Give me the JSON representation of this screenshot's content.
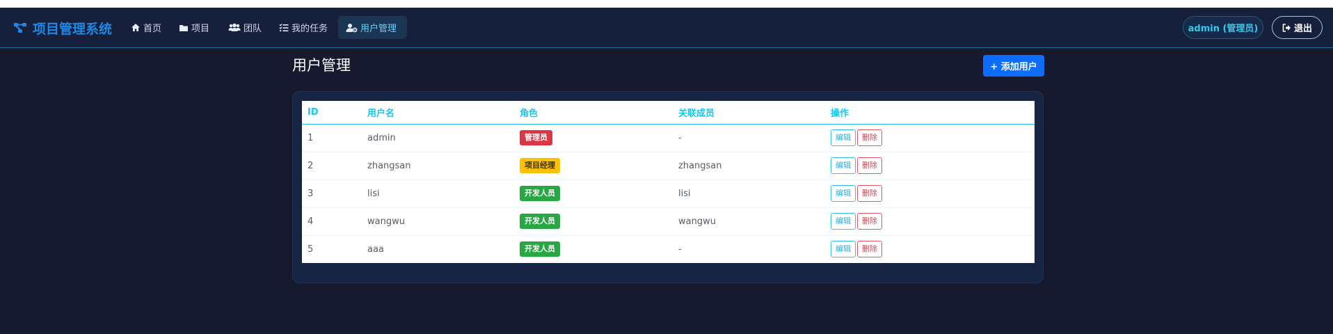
{
  "brand": {
    "title": "项目管理系统"
  },
  "nav": {
    "home": "首页",
    "projects": "项目",
    "team": "团队",
    "my_tasks": "我的任务",
    "user_management": "用户管理"
  },
  "user_badge": "admin (管理员)",
  "logout": "退出",
  "page": {
    "title": "用户管理",
    "add_user": "+ 添加用户"
  },
  "table": {
    "headers": [
      "ID",
      "用户名",
      "角色",
      "关联成员",
      "操作"
    ],
    "rows": [
      {
        "id": "1",
        "username": "admin",
        "role": "管理员",
        "member": "-"
      },
      {
        "id": "2",
        "username": "zhangsan",
        "role": "项目经理",
        "member": "zhangsan"
      },
      {
        "id": "3",
        "username": "lisi",
        "role": "开发人员",
        "member": "lisi"
      },
      {
        "id": "4",
        "username": "wangwu",
        "role": "开发人员",
        "member": "wangwu"
      },
      {
        "id": "5",
        "username": "aaa",
        "role": "开发人员",
        "member": "-"
      }
    ],
    "edit_label": "编辑",
    "delete_label": "删除"
  },
  "colors": {
    "brand": "#1e88e5",
    "accent": "#16c6ef",
    "admin_badge": "#dc3545",
    "pm_badge": "#ffc107",
    "dev_badge": "#28a745",
    "primary_button": "#0d6efd"
  },
  "icons": {
    "brand": "project-diagram-icon",
    "home": "home-icon",
    "projects": "folder-icon",
    "team": "users-icon",
    "tasks": "tasks-icon",
    "user_management": "user-gear-icon",
    "logout": "sign-out-icon"
  }
}
